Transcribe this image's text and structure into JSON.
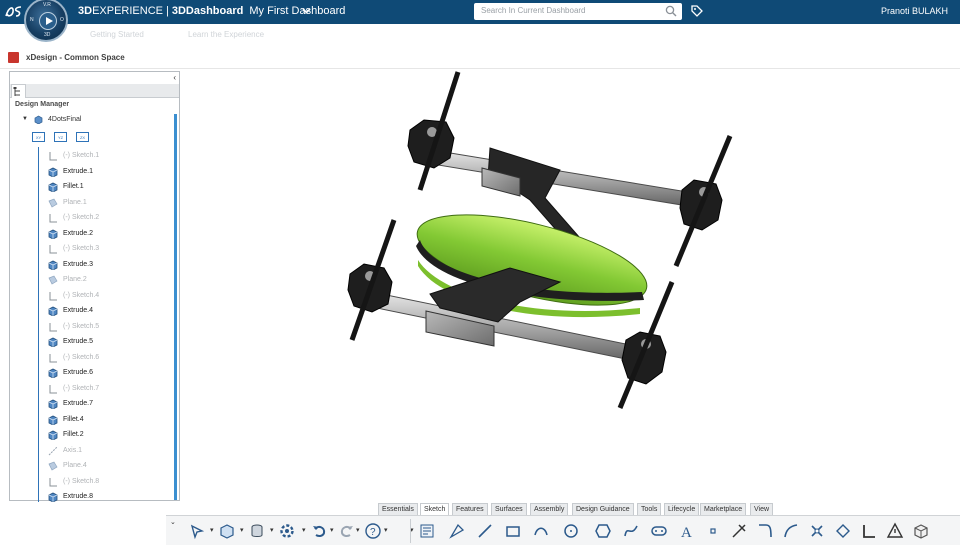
{
  "topbar": {
    "brand_3d": "3D",
    "brand_experience": "EXPERIENCE",
    "brand_sep": "|",
    "brand_app_3d": "3D",
    "brand_app": "Dashboard",
    "dashboard_name": "My First Dashboard",
    "search_placeholder": "Search In Current Dashboard",
    "user_name": "Pranoti BULAKH",
    "compass_letters": {
      "top": "V.R",
      "left": "N",
      "right": "O",
      "bottom": "3D"
    }
  },
  "tabs": [
    "Getting Started",
    "Learn the Experience"
  ],
  "app": {
    "title": "xDesign - Common Space"
  },
  "design_manager": {
    "title": "Design Manager",
    "root": "4DotsFinal",
    "planes": [
      "XY",
      "YZ",
      "ZX"
    ],
    "items": [
      {
        "label": "(-) Sketch.1",
        "type": "sketch",
        "dim": true
      },
      {
        "label": "Extrude.1",
        "type": "feature",
        "dim": false
      },
      {
        "label": "Fillet.1",
        "type": "feature",
        "dim": false
      },
      {
        "label": "Plane.1",
        "type": "plane",
        "dim": true
      },
      {
        "label": "(-) Sketch.2",
        "type": "sketch",
        "dim": true
      },
      {
        "label": "Extrude.2",
        "type": "feature",
        "dim": false
      },
      {
        "label": "(-) Sketch.3",
        "type": "sketch",
        "dim": true
      },
      {
        "label": "Extrude.3",
        "type": "feature",
        "dim": false
      },
      {
        "label": "Plane.2",
        "type": "plane",
        "dim": true
      },
      {
        "label": "(-) Sketch.4",
        "type": "sketch",
        "dim": true
      },
      {
        "label": "Extrude.4",
        "type": "feature",
        "dim": false
      },
      {
        "label": "(-) Sketch.5",
        "type": "sketch",
        "dim": true
      },
      {
        "label": "Extrude.5",
        "type": "feature",
        "dim": false
      },
      {
        "label": "(-) Sketch.6",
        "type": "sketch",
        "dim": true
      },
      {
        "label": "Extrude.6",
        "type": "feature",
        "dim": false
      },
      {
        "label": "(-) Sketch.7",
        "type": "sketch",
        "dim": true
      },
      {
        "label": "Extrude.7",
        "type": "feature",
        "dim": false
      },
      {
        "label": "Fillet.4",
        "type": "feature",
        "dim": false
      },
      {
        "label": "Fillet.2",
        "type": "feature",
        "dim": false
      },
      {
        "label": "Axis.1",
        "type": "axis",
        "dim": true
      },
      {
        "label": "Plane.4",
        "type": "plane",
        "dim": true
      },
      {
        "label": "(-) Sketch.8",
        "type": "sketch",
        "dim": true
      },
      {
        "label": "Extrude.8",
        "type": "feature",
        "dim": false
      }
    ]
  },
  "action_tabs": [
    "Essentials",
    "Sketch",
    "Features",
    "Surfaces",
    "Assembly",
    "Design Guidance",
    "Tools",
    "Lifecycle",
    "Marketplace",
    "View"
  ],
  "active_action_tab": "Sketch",
  "toolbar_icons": [
    "select-icon",
    "part-icon",
    "save-icon",
    "settings-icon",
    "undo-icon",
    "redo-icon",
    "help-icon",
    "sketch-icon",
    "smart-dimension-icon",
    "line-icon",
    "rectangle-icon",
    "arc-icon",
    "circle-icon",
    "polygon-icon",
    "spline-icon",
    "slot-icon",
    "text-icon",
    "point-icon",
    "trim-icon",
    "fillet-icon",
    "offset-icon",
    "transform-icon",
    "constraint-icon",
    "corner-icon",
    "warning-icon",
    "box-icon"
  ],
  "colors": {
    "topbar": "#0f4a76",
    "accent": "#3b8fd0",
    "body_green": "#7fc832",
    "frame_dark": "#2b2b2b"
  }
}
